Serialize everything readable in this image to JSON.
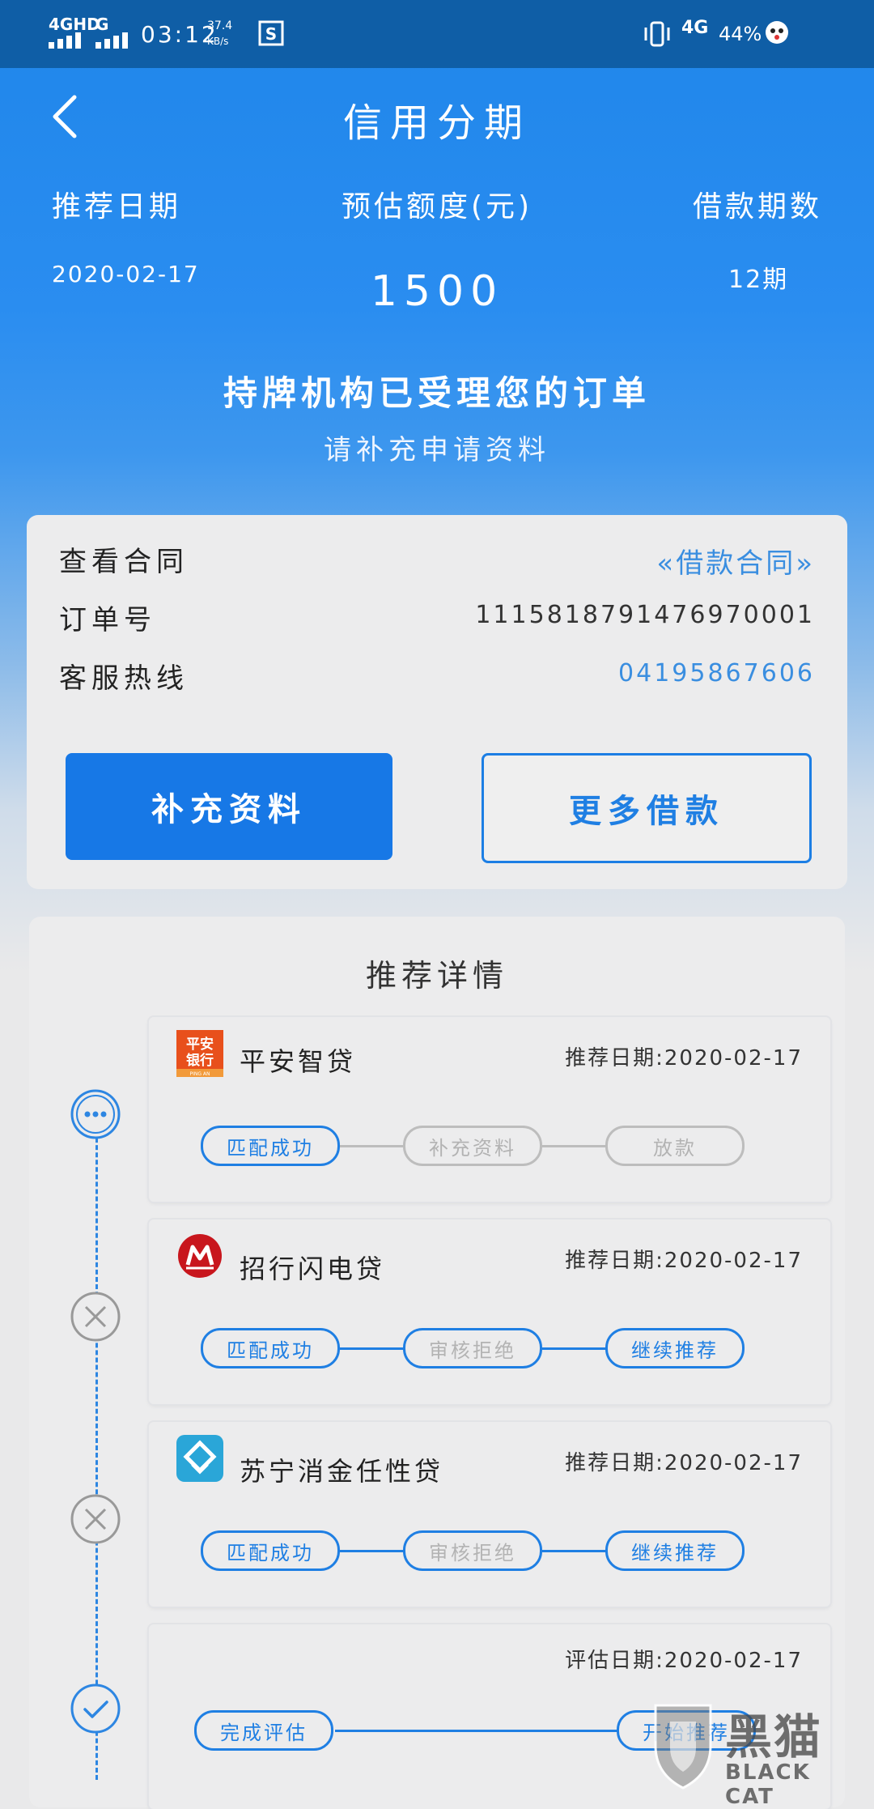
{
  "status_bar": {
    "network1": "4GHD",
    "network2": "G",
    "time": "03:12",
    "speed": "37.4",
    "speed_unit": "KB/s",
    "network3": "4G",
    "battery": "44%"
  },
  "header": {
    "title": "信用分期"
  },
  "summary": {
    "date_label": "推荐日期",
    "amount_label": "预估额度(元)",
    "periods_label": "借款期数",
    "date_value": "2020-02-17",
    "amount_value": "1500",
    "periods_value": "12期"
  },
  "status": {
    "main": "持牌机构已受理您的订单",
    "sub": "请补充申请资料"
  },
  "order_card": {
    "contract_label": "查看合同",
    "contract_link": "«借款合同»",
    "order_label": "订单号",
    "order_value": "1115818791476970001",
    "hotline_label": "客服热线",
    "hotline_value": "04195867606",
    "btn_supplement": "补充资料",
    "btn_more": "更多借款"
  },
  "recommend": {
    "title": "推荐详情",
    "lenders": [
      {
        "name": "平安智贷",
        "logo_text": "平安银行",
        "logo_sub": "PING AN",
        "date": "推荐日期:2020-02-17",
        "steps": [
          "匹配成功",
          "补充资料",
          "放款"
        ]
      },
      {
        "name": "招行闪电贷",
        "date": "推荐日期:2020-02-17",
        "steps": [
          "匹配成功",
          "审核拒绝",
          "继续推荐"
        ]
      },
      {
        "name": "苏宁消金任性贷",
        "date": "推荐日期:2020-02-17",
        "steps": [
          "匹配成功",
          "审核拒绝",
          "继续推荐"
        ]
      },
      {
        "date": "评估日期:2020-02-17",
        "steps": [
          "完成评估",
          "开始推荐"
        ]
      }
    ]
  },
  "watermark": {
    "cn": "黑猫",
    "en": "BLACK CAT"
  },
  "colors": {
    "primary": "#1778e6",
    "status_bar": "#0f5ea6",
    "link": "#3a8ee0"
  }
}
